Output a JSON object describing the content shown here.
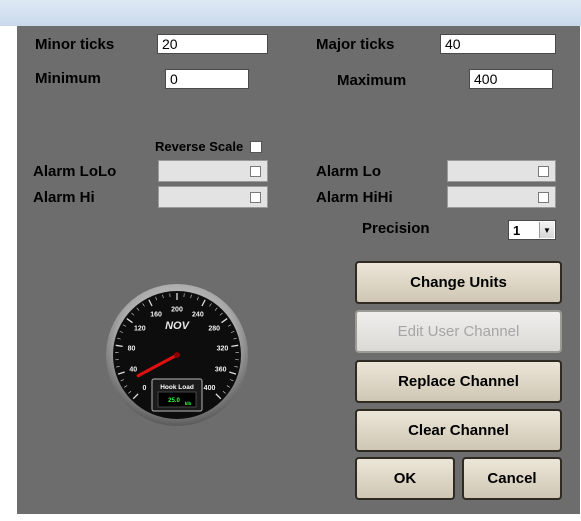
{
  "scale": {
    "minor_ticks": {
      "label": "Minor ticks",
      "value": "20"
    },
    "major_ticks": {
      "label": "Major ticks",
      "value": "40"
    },
    "minimum": {
      "label": "Minimum",
      "value": "0"
    },
    "maximum": {
      "label": "Maximum",
      "value": "400"
    },
    "reverse_scale": {
      "label": "Reverse Scale",
      "checked": false
    }
  },
  "alarms": {
    "lolo": {
      "label": "Alarm LoLo",
      "enabled": false
    },
    "lo": {
      "label": "Alarm Lo",
      "enabled": false
    },
    "hi": {
      "label": "Alarm Hi",
      "enabled": false
    },
    "hihi": {
      "label": "Alarm HiHi",
      "enabled": false
    }
  },
  "precision": {
    "label": "Precision",
    "value": "1"
  },
  "gauge": {
    "logo": "NOV",
    "tick_labels": [
      "0",
      "40",
      "80",
      "120",
      "160",
      "200",
      "240",
      "280",
      "320",
      "360",
      "400"
    ],
    "readout_title": "Hook Load",
    "readout_value": "25.0",
    "readout_unit": "klb",
    "value": 25.0,
    "min": 0,
    "max": 400,
    "needle_color": "#e01010",
    "readout_color": "#37ff4b"
  },
  "buttons": {
    "change_units": "Change Units",
    "edit_user_channel": "Edit User Channel",
    "replace_channel": "Replace Channel",
    "clear_channel": "Clear Channel",
    "ok": "OK",
    "cancel": "Cancel"
  }
}
